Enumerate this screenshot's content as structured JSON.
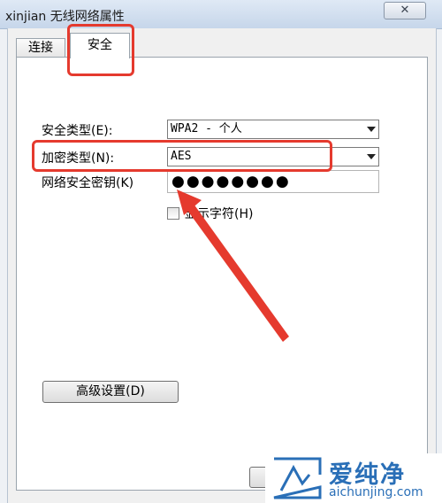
{
  "window": {
    "title": "xinjian 无线网络属性",
    "close_label": "✕"
  },
  "tabs": [
    {
      "label": "连接",
      "selected": false
    },
    {
      "label": "安全",
      "selected": true
    }
  ],
  "security": {
    "type_label": "安全类型(E):",
    "type_value": "WPA2 - 个人",
    "encryption_label": "加密类型(N):",
    "encryption_value": "AES",
    "key_label": "网络安全密钥(K)",
    "key_value": "●●●●●●●●",
    "show_chars_label": "显示字符(H)",
    "show_chars_checked": false,
    "advanced_label": "高级设置(D)"
  },
  "watermark": {
    "brand": "爱纯净",
    "domain": "aichunjing.com",
    "color": "#2a6fb7"
  },
  "annotation_color": "#e53a2e"
}
